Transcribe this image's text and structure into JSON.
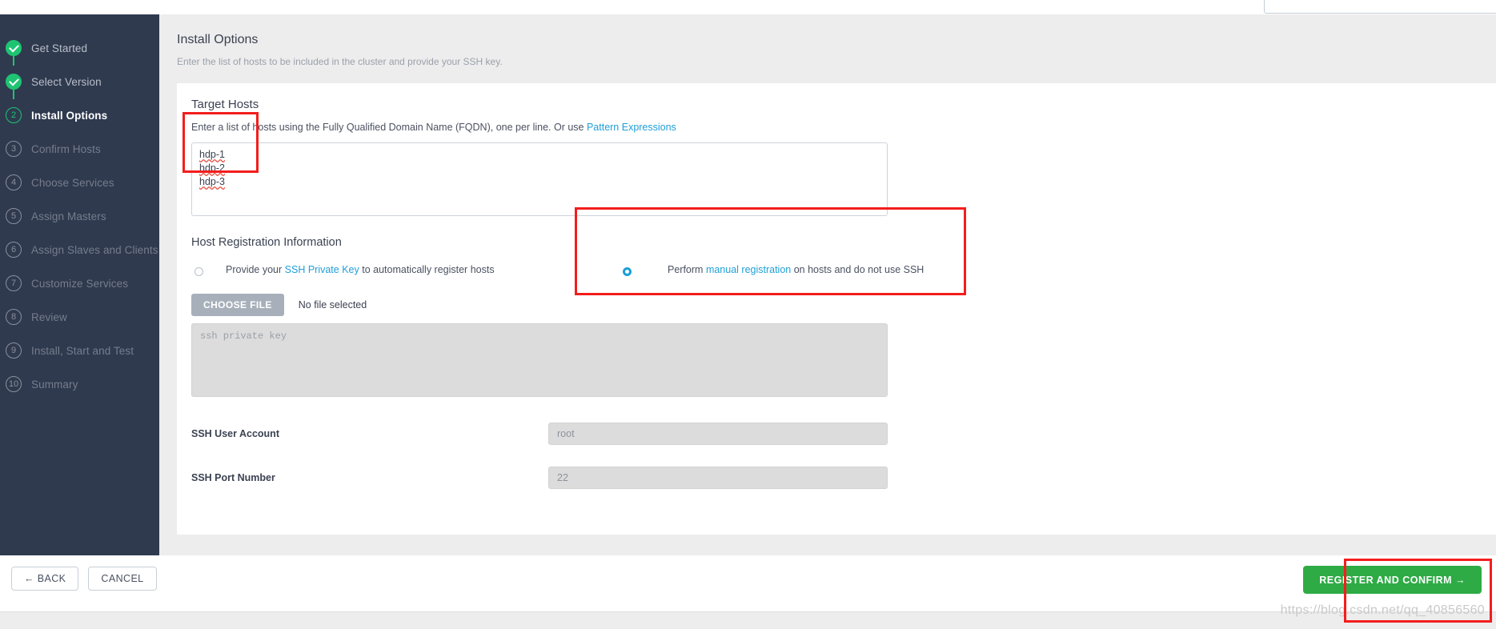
{
  "sidebar": {
    "steps": [
      {
        "num": "1",
        "label": "Get Started",
        "state": "done"
      },
      {
        "num": "2",
        "label": "Select Version",
        "state": "done"
      },
      {
        "num": "2",
        "label": "Install Options",
        "state": "current"
      },
      {
        "num": "3",
        "label": "Confirm Hosts",
        "state": "todo"
      },
      {
        "num": "4",
        "label": "Choose Services",
        "state": "todo"
      },
      {
        "num": "5",
        "label": "Assign Masters",
        "state": "todo"
      },
      {
        "num": "6",
        "label": "Assign Slaves and Clients",
        "state": "todo"
      },
      {
        "num": "7",
        "label": "Customize Services",
        "state": "todo"
      },
      {
        "num": "8",
        "label": "Review",
        "state": "todo"
      },
      {
        "num": "9",
        "label": "Install, Start and Test",
        "state": "todo"
      },
      {
        "num": "10",
        "label": "Summary",
        "state": "todo"
      }
    ]
  },
  "page": {
    "title": "Install Options",
    "subtitle": "Enter the list of hosts to be included in the cluster and provide your SSH key."
  },
  "target_hosts": {
    "title": "Target Hosts",
    "desc_prefix": "Enter a list of hosts using the Fully Qualified Domain Name (FQDN), one per line. Or use ",
    "desc_link": "Pattern Expressions",
    "hosts": [
      "hdp-1",
      "hdp-2",
      "hdp-3"
    ]
  },
  "host_registration": {
    "title": "Host Registration Information",
    "option_ssh": {
      "prefix": "Provide your ",
      "link": "SSH Private Key",
      "suffix": " to automatically register hosts",
      "selected": false
    },
    "option_manual": {
      "prefix": "Perform ",
      "link": "manual registration",
      "suffix": " on hosts and do not use SSH",
      "selected": true
    },
    "choose_file_label": "CHOOSE FILE",
    "file_status": "No file selected",
    "ssh_key_placeholder": "ssh private key",
    "ssh_user_label": "SSH User Account",
    "ssh_user_value": "root",
    "ssh_port_label": "SSH Port Number",
    "ssh_port_value": "22"
  },
  "footer": {
    "back_label": "← BACK",
    "cancel_label": "CANCEL",
    "register_label": "REGISTER AND CONFIRM →"
  },
  "watermark": "https://blog.csdn.net/qq_40856560",
  "colors": {
    "sidebar_bg": "#2f3a4f",
    "accent_green": "#1ec472",
    "button_green": "#2eab45",
    "link_blue": "#1f9fd8",
    "radio_blue": "#1b9fd8",
    "annotation_red": "#f41d1d"
  }
}
